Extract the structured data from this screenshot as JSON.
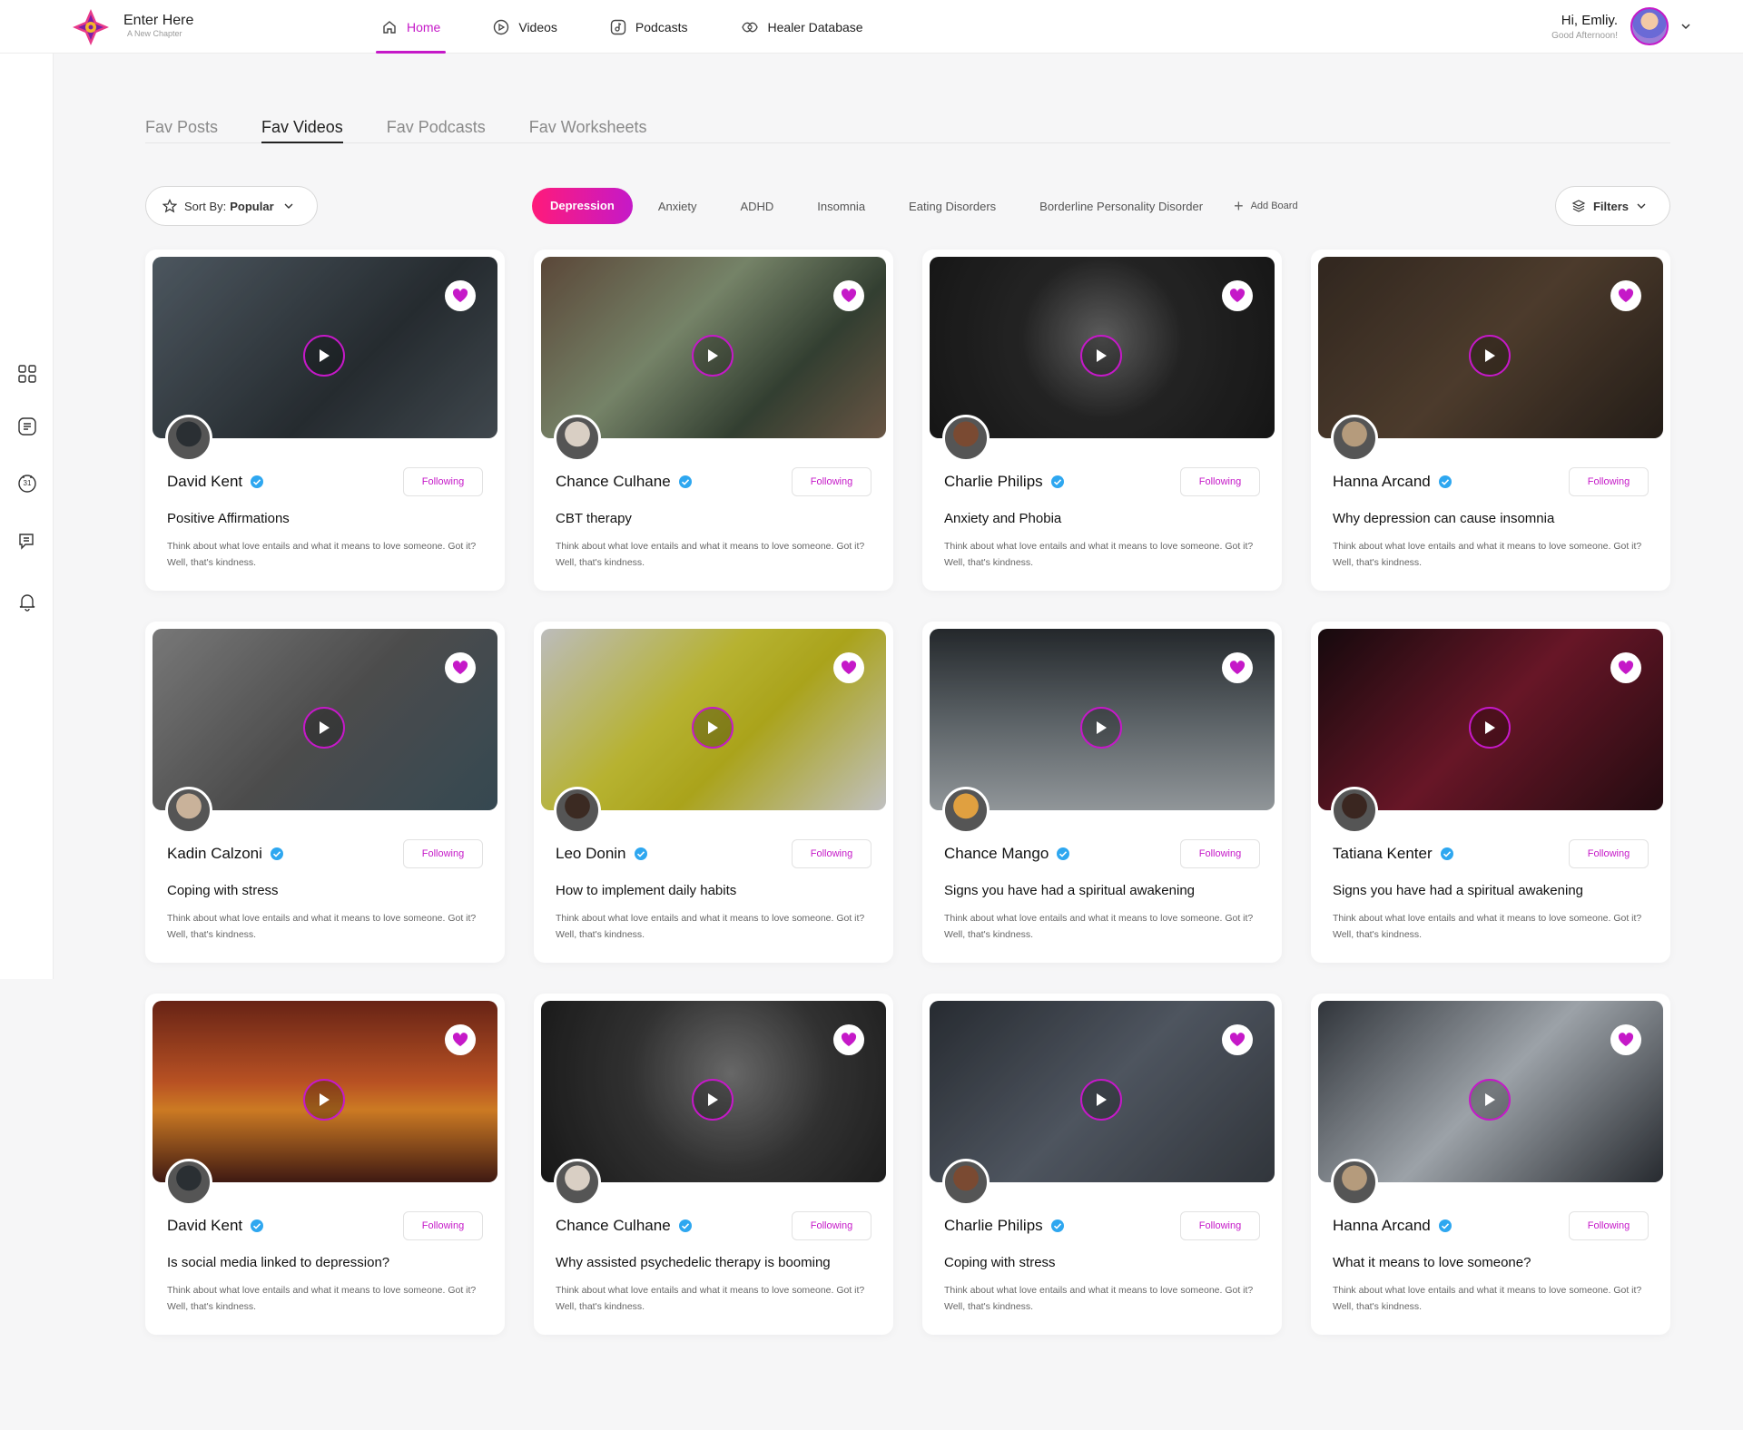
{
  "app": {
    "title": "Enter Here",
    "subtitle": "A New Chapter"
  },
  "nav": {
    "items": [
      {
        "label": "Home",
        "icon": "home-icon",
        "active": true
      },
      {
        "label": "Videos",
        "icon": "play-circle-icon"
      },
      {
        "label": "Podcasts",
        "icon": "podcast-icon"
      },
      {
        "label": "Healer Database",
        "icon": "healer-icon"
      }
    ]
  },
  "user": {
    "greeting_prefix": "Hi,",
    "name": "Emliy.",
    "subtext": "Good Afternoon!"
  },
  "rail": {
    "icons": [
      "grid-icon",
      "posts-icon",
      "calendar-icon",
      "chat-icon",
      "bell-icon"
    ],
    "calendar_day": "31"
  },
  "fav_tabs": [
    "Fav Posts",
    "Fav Videos",
    "Fav Podcasts",
    "Fav Worksheets"
  ],
  "fav_tab_active": "Fav Videos",
  "sort": {
    "label": "Sort By:",
    "value": "Popular"
  },
  "categories": [
    "Depression",
    "Anxiety",
    "ADHD",
    "Insomnia",
    "Eating Disorders",
    "Borderline Personality Disorder"
  ],
  "category_active": "Depression",
  "add_board": "Add Board",
  "filters_label": "Filters",
  "colors": {
    "accent": "#c519c8",
    "accent_pink": "#ff1a7a",
    "verified": "#2ea7f0"
  },
  "follow_label": "Following",
  "description": "Think about what love entails and what it means to love someone. Got it? Well, that's kindness.",
  "cards": [
    {
      "author": "David Kent",
      "title": "Positive Affirmations",
      "bg": "linear-gradient(135deg,#5a6670,#2c3338 60%,#4b545b)",
      "av": "#2a2f33"
    },
    {
      "author": "Chance Culhane",
      "title": "CBT therapy",
      "bg": "linear-gradient(135deg,#6b5443,#8a9a7a 40%,#3c4a3a 70%,#7b6450)",
      "av": "#d9cfc4"
    },
    {
      "author": "Charlie Philips",
      "title": "Anxiety and Phobia",
      "bg": "radial-gradient(circle at 50% 45%,#6d6d6d,#2a2a2a 40%,#1a1a1a)",
      "av": "#7a4a32"
    },
    {
      "author": "Hanna Arcand",
      "title": "Why depression can cause insomnia",
      "bg": "linear-gradient(135deg,#3a2e25,#5a4634 50%,#2a221c)",
      "av": "#b59b7c"
    },
    {
      "author": "Kadin Calzoni",
      "title": "Coping with stress",
      "bg": "linear-gradient(135deg,#8d8d8d,#5a5a5a 50%,#3f5560)",
      "av": "#c9b29a"
    },
    {
      "author": "Leo Donin",
      "title": "How to implement daily habits",
      "bg": "linear-gradient(135deg,#ddd,#d7d23a 40%,#c8c020 60%,#e2e2e2)",
      "av": "#3b2a22"
    },
    {
      "author": "Chance Mango",
      "title": "Signs you have had a spiritual awakening",
      "bg": "linear-gradient(180deg,#2a2f33,#6b7378 50%,#aab0b4)",
      "av": "#e0a040"
    },
    {
      "author": "Tatiana Kenter",
      "title": "Signs you have had a spiritual awakening",
      "bg": "linear-gradient(135deg,#1a0c10,#7a1a2e 50%,#2a0e14)",
      "av": "#3a2620"
    },
    {
      "author": "David Kent",
      "title": "Is social media linked to depression?",
      "bg": "linear-gradient(180deg,#7a2a1a,#d9602a 45%,#f0902a 60%,#4a1e16)",
      "av": "#2a2f33"
    },
    {
      "author": "Chance Culhane",
      "title": "Why assisted psychedelic therapy is booming",
      "bg": "radial-gradient(circle at 55% 40%,#7a7a7a,#3a3a3a 45%,#1c1c1c)",
      "av": "#d9cfc4"
    },
    {
      "author": "Charlie Philips",
      "title": "Coping with stress",
      "bg": "linear-gradient(135deg,#2e333a,#5c6470 50%,#3a3f46)",
      "av": "#7a4a32"
    },
    {
      "author": "Hanna Arcand",
      "title": "What it means to love someone?",
      "bg": "linear-gradient(135deg,#3a3f46,#b8bfc6 50%,#2e3238)",
      "av": "#b59b7c"
    }
  ]
}
